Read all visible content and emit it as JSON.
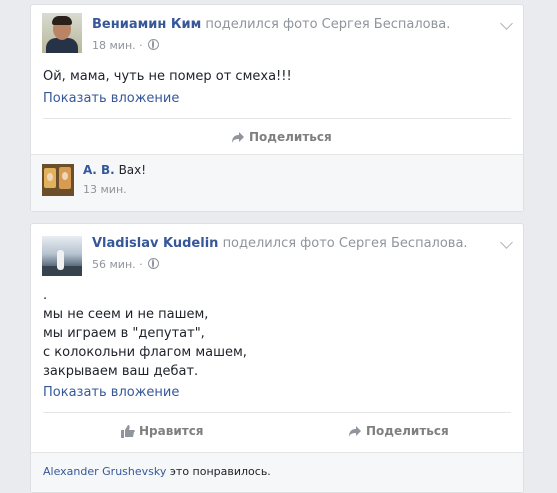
{
  "posts": [
    {
      "author": "Вениамин Ким",
      "action": "поделился фото Сергея Беспалова.",
      "time": "18 мин.",
      "text": "Ой, мама, чуть не помер от смеха!!!",
      "attachment_link": "Показать вложение",
      "share_label": "Поделиться",
      "comment": {
        "author": "А. В.",
        "text": "Вах!",
        "time": "13 мин."
      }
    },
    {
      "author": "Vladislav Kudelin",
      "action": "поделился фото Сергея Беспалова.",
      "time": "56 мин.",
      "text": ".\nмы не сеем и не пашем,\nмы играем в \"депутат\",\nс колокольни флагом машем,\nзакрываем ваш дебат.",
      "attachment_link": "Показать вложение",
      "like_label": "Нравится",
      "share_label": "Поделиться",
      "likes": {
        "name": "Alexander Grushevsky",
        "text": "это понравилось."
      }
    }
  ]
}
